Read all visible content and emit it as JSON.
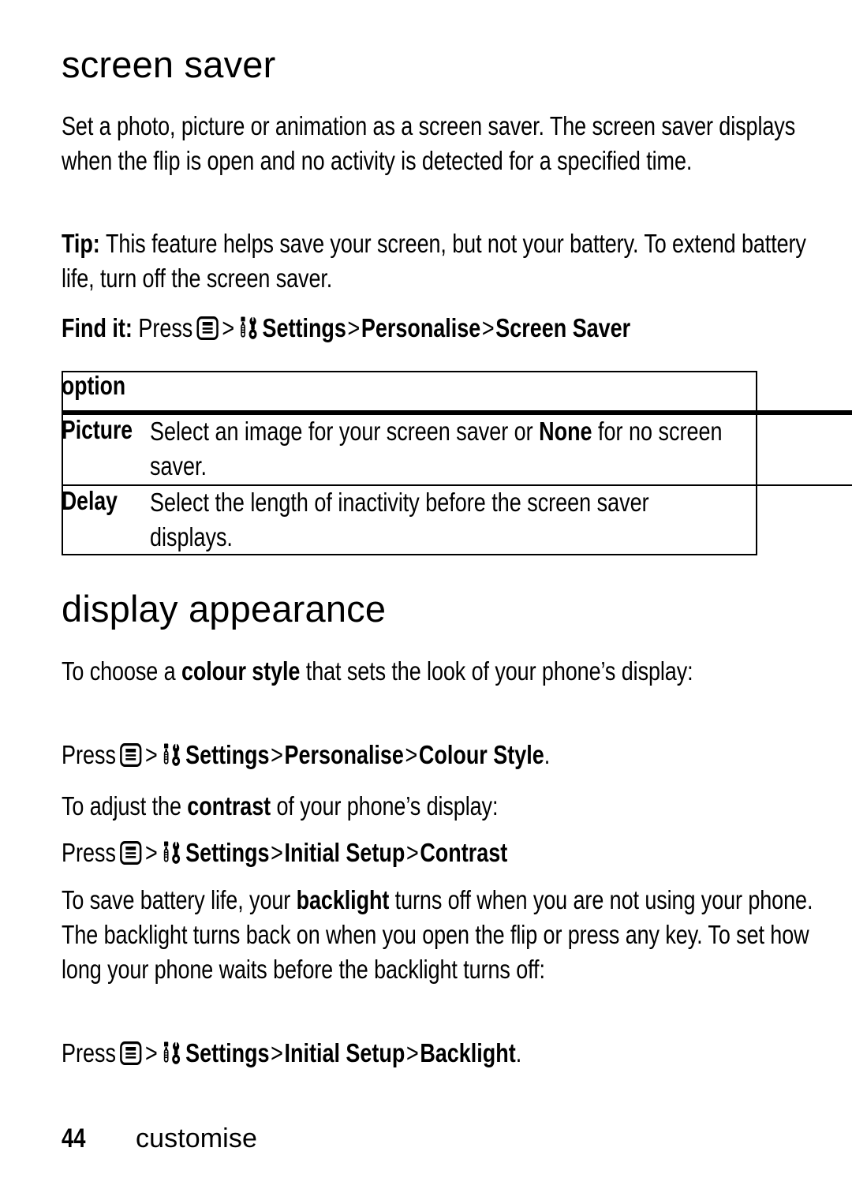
{
  "document": {
    "type": "phone-user-guide-page",
    "page_number": "44",
    "footer_section": "customise"
  },
  "sections": [
    {
      "id": "screen-saver",
      "heading": "screen saver",
      "intro": "Set a photo, picture or animation as a screen saver. The screen saver displays when the flip is open and no activity is detected for a specified time.",
      "tip_label": "Tip:",
      "tip_text": "This feature helps save your screen, but not your battery. To extend battery life, turn off the screen saver.",
      "find_it_label": "Find it:",
      "find_it_press": "Press",
      "find_it_path": [
        "Settings",
        "Personalise",
        "Screen Saver"
      ]
    },
    {
      "id": "display-appearance",
      "heading": "display appearance",
      "colour_style_lead_1": "To choose a ",
      "colour_style_lead_bold": "colour style",
      "colour_style_lead_2": " that sets the look of your phone’s display:",
      "colour_style_press": "Press",
      "colour_style_path": [
        "Settings",
        "Personalise",
        "Colour Style"
      ],
      "colour_style_period": ".",
      "contrast_lead_1": "To adjust the ",
      "contrast_lead_bold": "contrast",
      "contrast_lead_2": " of your phone’s display:",
      "contrast_press": "Press",
      "contrast_path": [
        "Settings",
        "Initial Setup",
        "Contrast"
      ],
      "contrast_period": "",
      "backlight_lead_1": "To save battery life, your ",
      "backlight_lead_bold": "backlight",
      "backlight_lead_2": " turns off when you are not using your phone. The backlight turns back on when you open the flip or press any key. To set how long your phone waits before the backlight turns off:",
      "backlight_press": "Press",
      "backlight_path": [
        "Settings",
        "Initial Setup",
        "Backlight"
      ],
      "backlight_period": "."
    }
  ],
  "option_table": {
    "header": "option",
    "rows": [
      {
        "key": "Picture",
        "value_1": "Select an image for your screen saver or ",
        "value_bold": "None",
        "value_2": " for no screen saver."
      },
      {
        "key": "Delay",
        "value_1": "Select the length of inactivity before the screen saver displays.",
        "value_bold": "",
        "value_2": ""
      }
    ]
  },
  "icons": {
    "menu": "menu-key-icon",
    "settings": "settings-tools-icon",
    "separator": ">"
  },
  "colors": {
    "text": "#000000",
    "background": "#ffffff",
    "rule": "#000000"
  }
}
